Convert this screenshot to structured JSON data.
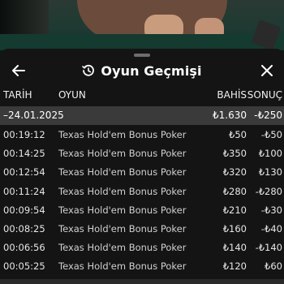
{
  "header": {
    "title": "Oyun Geçmişi",
    "back_icon": "arrow-left-icon",
    "history_icon": "history-clock-icon",
    "close_icon": "close-icon"
  },
  "columns": {
    "date": "TARİH",
    "game": "OYUN",
    "bet": "BAHİS",
    "result": "SONUÇ"
  },
  "group": {
    "date": "–24.01.2025",
    "bet": "₺1.630",
    "result": "-₺250"
  },
  "rows": [
    {
      "time": "00:19:12",
      "game": "Texas Hold'em Bonus Poker",
      "bet": "₺50",
      "result": "-₺50"
    },
    {
      "time": "00:14:25",
      "game": "Texas Hold'em Bonus Poker",
      "bet": "₺350",
      "result": "₺100"
    },
    {
      "time": "00:12:54",
      "game": "Texas Hold'em Bonus Poker",
      "bet": "₺320",
      "result": "₺130"
    },
    {
      "time": "00:11:24",
      "game": "Texas Hold'em Bonus Poker",
      "bet": "₺280",
      "result": "-₺280"
    },
    {
      "time": "00:09:54",
      "game": "Texas Hold'em Bonus Poker",
      "bet": "₺210",
      "result": "-₺30"
    },
    {
      "time": "00:08:25",
      "game": "Texas Hold'em Bonus Poker",
      "bet": "₺160",
      "result": "-₺40"
    },
    {
      "time": "00:06:56",
      "game": "Texas Hold'em Bonus Poker",
      "bet": "₺140",
      "result": "-₺140"
    },
    {
      "time": "00:05:25",
      "game": "Texas Hold'em Bonus Poker",
      "bet": "₺120",
      "result": "₺60"
    }
  ],
  "colors": {
    "panel": "#141414",
    "group_row": "#3a3a3a",
    "text": "#ffffff"
  }
}
